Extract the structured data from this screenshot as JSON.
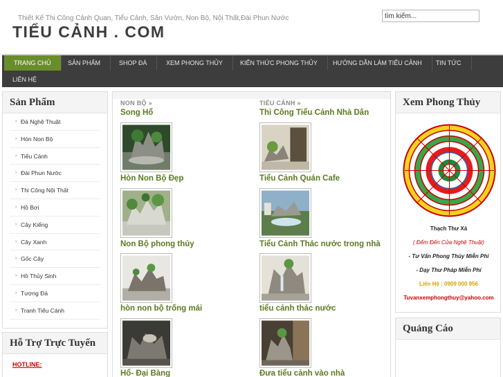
{
  "header": {
    "tagline": "Thiết Kế Thi Công Cảnh Quan, Tiểu Cảnh, Sân Vườn, Non Bộ, Nội Thất,Đài Phun Nước",
    "logo": "TIỂU CẢNH . COM",
    "search_value": "tìm kiếm..."
  },
  "nav": {
    "items": [
      {
        "label": "TRANG CHỦ",
        "active": true
      },
      {
        "label": "SẢN PHẨM"
      },
      {
        "label": "SHOP ĐÁ"
      },
      {
        "label": "XEM PHONG THỦY"
      },
      {
        "label": "KIẾN THỨC PHONG THỦY"
      },
      {
        "label": "HƯỚNG DẪN LÀM TIỂU CẢNH"
      },
      {
        "label": "TIN TỨC"
      },
      {
        "label": "LIÊN HỆ"
      }
    ]
  },
  "sidebar": {
    "title": "Sản Phẩm",
    "bullet": "›",
    "items": [
      "Đá Nghệ Thuật",
      "Hòn Non Bộ",
      "Tiểu Cảnh",
      "Đài Phun Nước",
      "Thi Công Nội Thất",
      "Hồ Bơi",
      "Cây Kiểng",
      "Cây Xanh",
      "Gốc Cây",
      "Hồ Thủy Sinh",
      "Tượng Đá",
      "Tranh Tiểu Cảnh"
    ]
  },
  "support": {
    "title": "Hỗ Trợ Trực Tuyến",
    "hotline": "HOTLINE:"
  },
  "main": {
    "left": {
      "section": "NON BỘ »",
      "first_title": "Song Hổ",
      "items": [
        "Hòn Non Bộ Đẹp",
        "Non Bộ phong thủy",
        "hòn non bộ trống mái",
        "Hổ- Đại Bàng"
      ]
    },
    "right": {
      "section": "TIỂU CẢNH »",
      "first_title": "Thi Công Tiểu Cảnh Nhà Dân",
      "items": [
        "Tiểu Cảnh Quán Cafe",
        "Tiểu Cảnh Thác nước trong nhà",
        "tiểu cảnh thác nước",
        "Đưa tiểu cảnh vào nhà"
      ]
    }
  },
  "phongthuy": {
    "title": "Xem Phong Thủy",
    "name": "Thạch Thư Xá",
    "slogan": "( Đếm Đến Cửa Nghệ Thuật)",
    "line1": "- Tư Vấn Phong Thủy Miễn Phí",
    "line2": "- Dạy Thư Pháp Miễn Phí",
    "contact": "Liên Hệ : 0909 000 956",
    "email": "Tuvanxemphongthuy@yahoo.com",
    "colors": {
      "name": "#222222",
      "slogan": "#cc0000",
      "lines": "#222222",
      "contact": "#d4a400",
      "email": "#cc0000"
    }
  },
  "ads": {
    "title": "Quảng Cáo"
  }
}
